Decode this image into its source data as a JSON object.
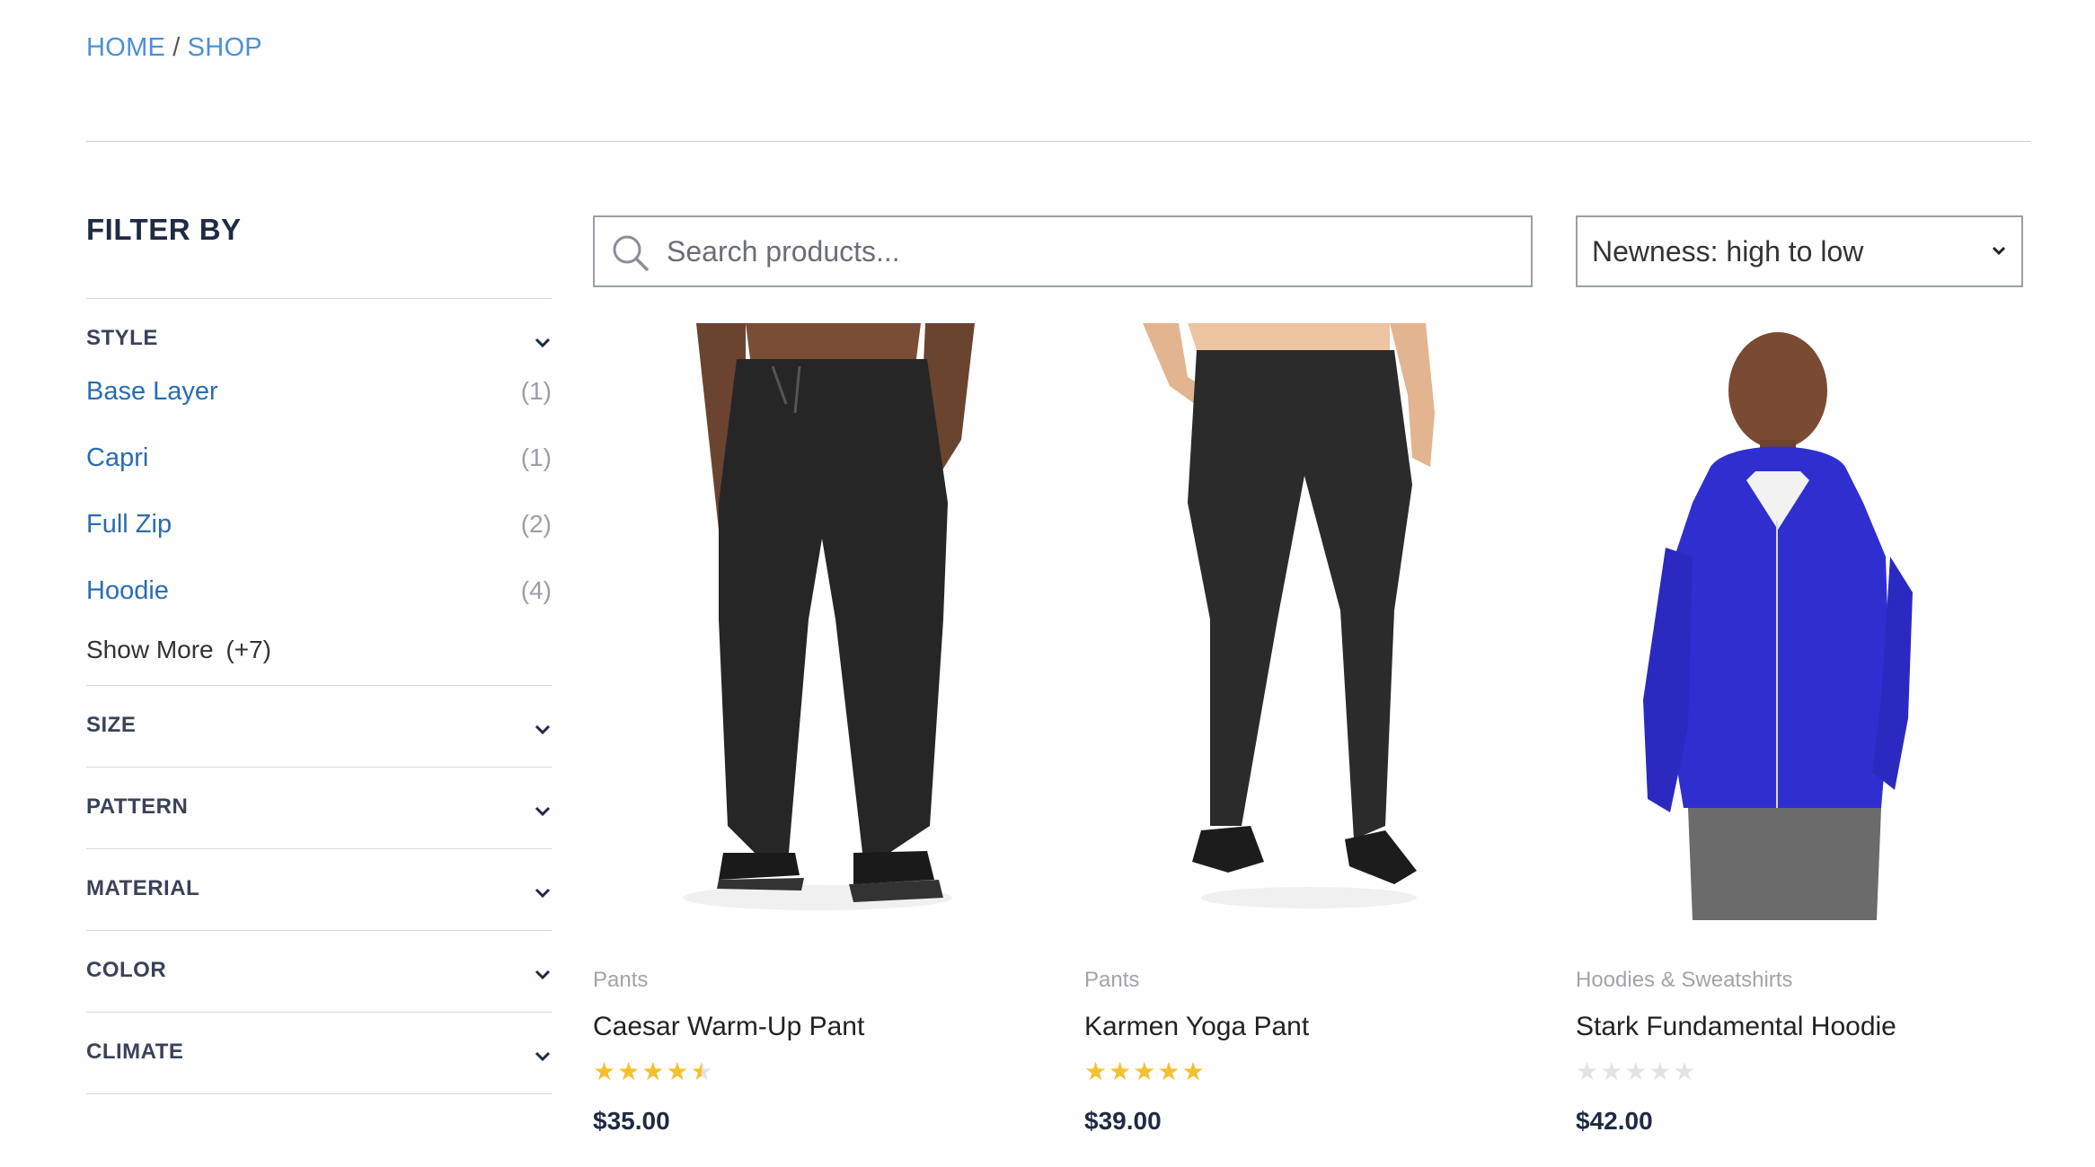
{
  "breadcrumb": {
    "home": "HOME",
    "separator": "/",
    "shop": "SHOP"
  },
  "sidebar": {
    "title": "FILTER BY",
    "style": {
      "label": "STYLE",
      "options": [
        {
          "label": "Base Layer",
          "count": "(1)"
        },
        {
          "label": "Capri",
          "count": "(1)"
        },
        {
          "label": "Full Zip",
          "count": "(2)"
        },
        {
          "label": "Hoodie",
          "count": "(4)"
        }
      ],
      "show_more": "Show More",
      "show_more_count": "(+7)"
    },
    "filters": [
      "SIZE",
      "PATTERN",
      "MATERIAL",
      "COLOR",
      "CLIMATE"
    ]
  },
  "search": {
    "placeholder": "Search products..."
  },
  "sort": {
    "value": "Newness: high to low"
  },
  "products": [
    {
      "category": "Pants",
      "name": "Caesar Warm-Up Pant",
      "rating": 4.5,
      "price": "$35.00"
    },
    {
      "category": "Pants",
      "name": "Karmen Yoga Pant",
      "rating": 5,
      "price": "$39.00"
    },
    {
      "category": "Hoodies & Sweatshirts",
      "name": "Stark Fundamental Hoodie",
      "rating": 0,
      "price": "$42.00"
    }
  ],
  "colors": {
    "link": "#2b6cb0",
    "breadcrumb": "#4a90d9",
    "star": "#f4c02e",
    "heading": "#1f2a44"
  }
}
